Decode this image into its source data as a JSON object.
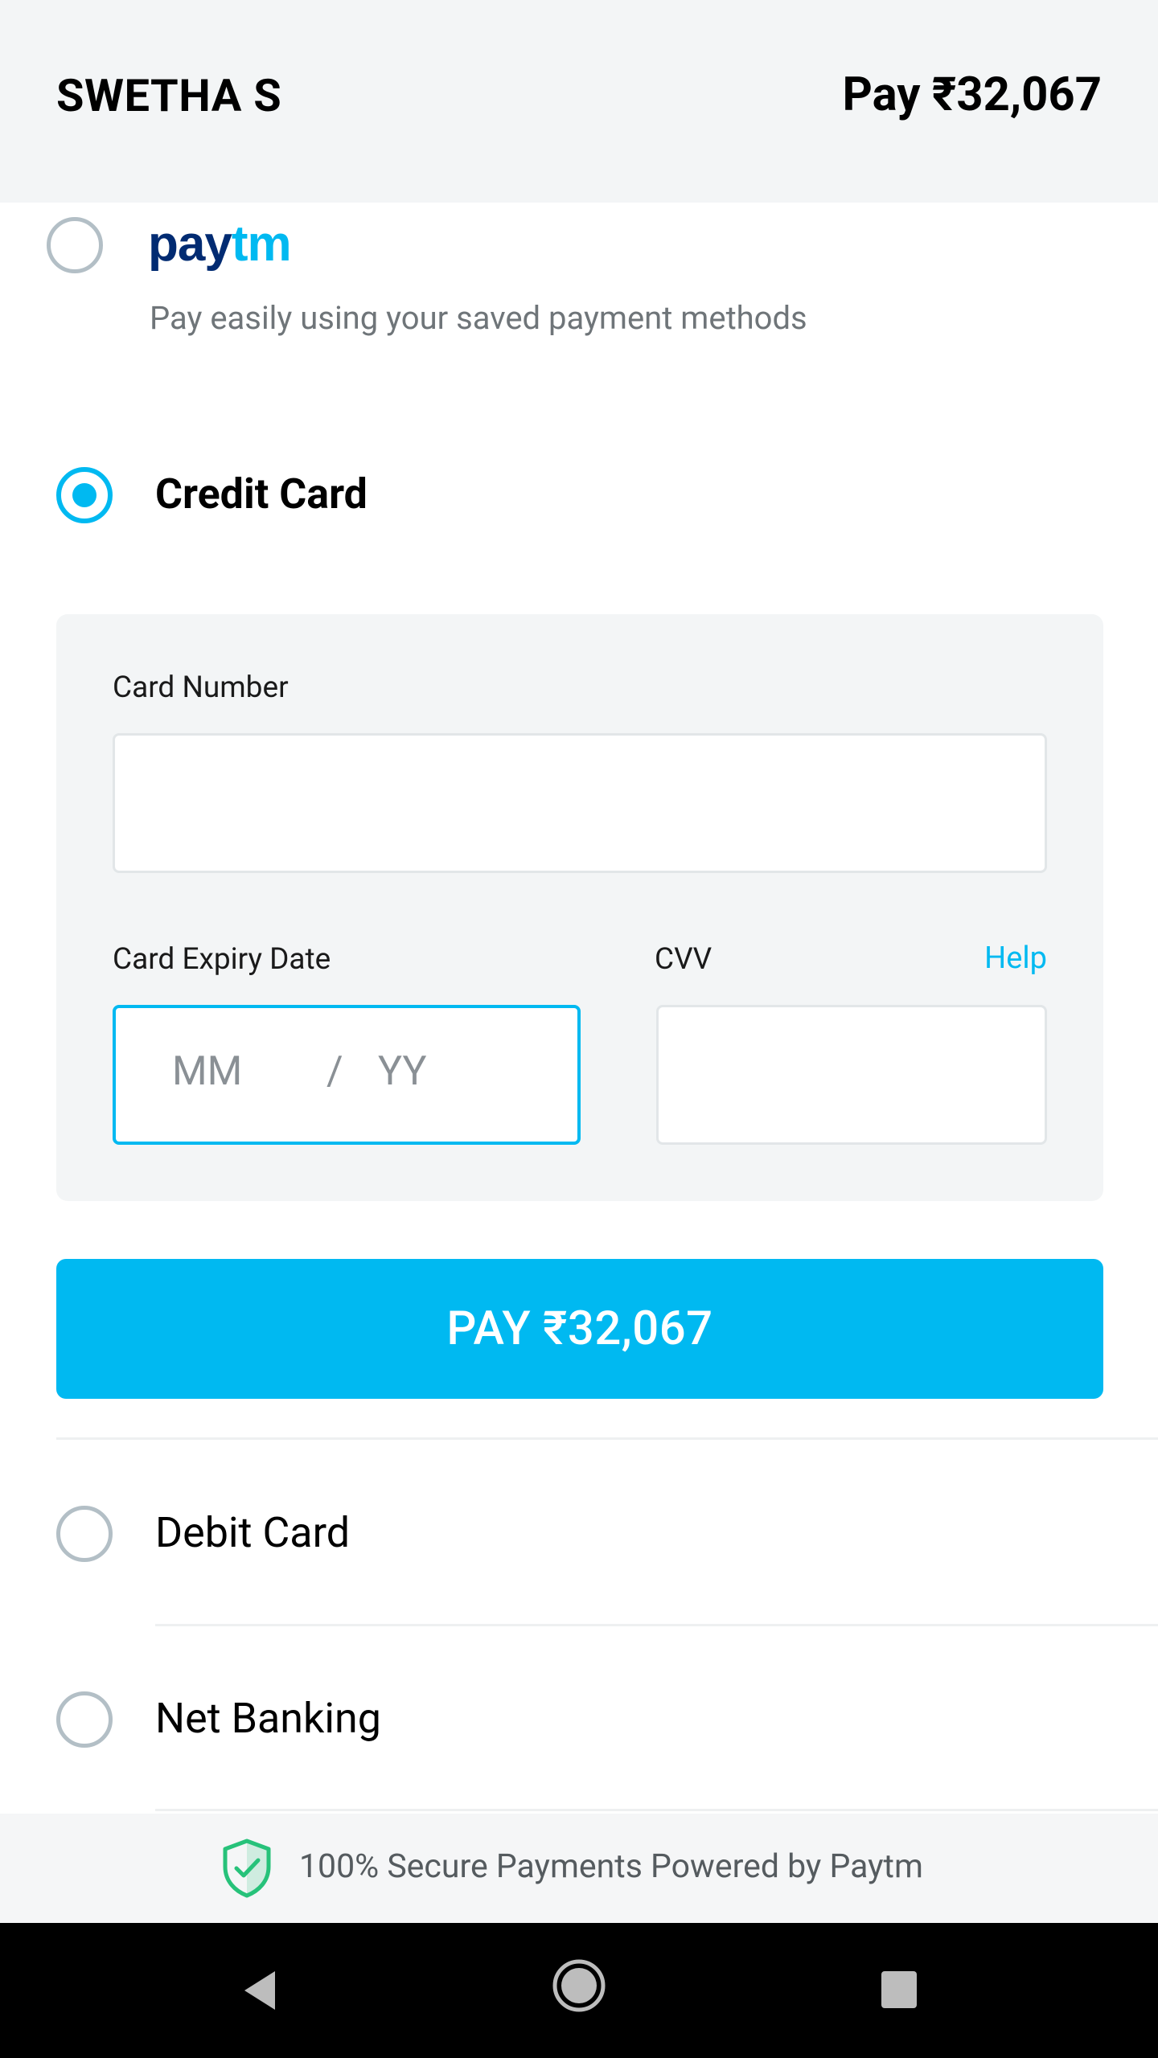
{
  "header": {
    "user_name": "SWETHA S",
    "pay_amount": "Pay ₹32,067"
  },
  "payment_methods": {
    "paytm": {
      "logo_pay": "pay",
      "logo_tm": "tm",
      "subtitle": "Pay easily using your saved payment methods",
      "selected": false
    },
    "credit_card": {
      "label": "Credit Card",
      "selected": true
    },
    "debit_card": {
      "label": "Debit Card",
      "selected": false
    },
    "net_banking": {
      "label": "Net Banking",
      "selected": false
    }
  },
  "card_form": {
    "card_number_label": "Card Number",
    "card_number_value": "",
    "expiry_label": "Card Expiry Date",
    "expiry_month_placeholder": "MM",
    "expiry_separator": "/",
    "expiry_year_placeholder": "YY",
    "cvv_label": "CVV",
    "cvv_value": "",
    "help_link": "Help"
  },
  "pay_button": {
    "label": "PAY ₹32,067"
  },
  "footer": {
    "secure_text": "100% Secure Payments Powered by Paytm",
    "icon": "shield-check-icon"
  },
  "navigation_bar": {
    "icons": [
      "back-icon",
      "home-icon",
      "recent-apps-icon"
    ]
  },
  "colors": {
    "accent": "#00b9f1",
    "paytm_dark_blue": "#012b72",
    "header_bg": "#f3f5f6",
    "radio_unselected": "#b3bfc6",
    "shield_green": "#27c27a"
  }
}
